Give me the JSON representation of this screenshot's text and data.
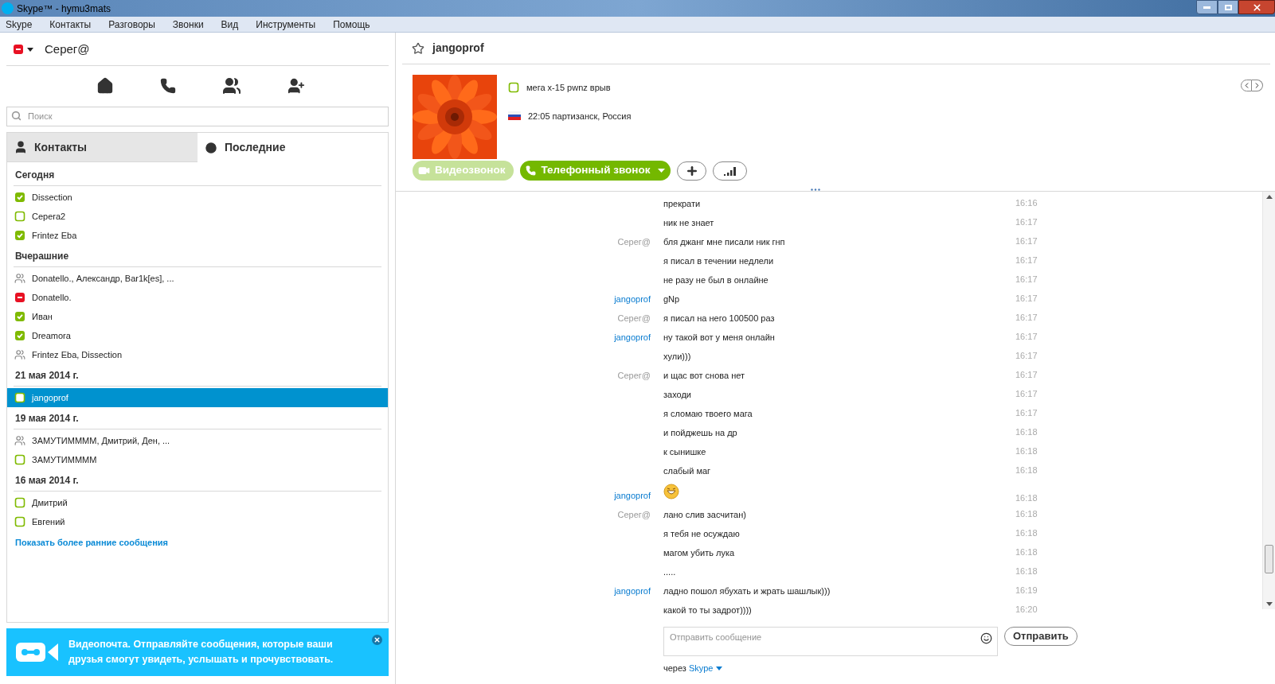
{
  "window": {
    "title": "Skype™ - hymu3mats"
  },
  "menu": [
    "Skype",
    "Контакты",
    "Разговоры",
    "Звонки",
    "Вид",
    "Инструменты",
    "Помощь"
  ],
  "profile": {
    "name": "Серег@",
    "kind": "busy"
  },
  "search": {
    "placeholder": "Поиск"
  },
  "tabs": [
    {
      "label": "Контакты",
      "kind": "contacts",
      "selected": false
    },
    {
      "label": "Последние",
      "kind": "recent",
      "selected": true
    }
  ],
  "recent_groups": [
    {
      "heading": "Сегодня",
      "items": [
        {
          "name": "Dissection",
          "kind": "online",
          "selected": false
        },
        {
          "name": "Cepera2",
          "kind": "offline",
          "selected": false
        },
        {
          "name": "Frintez Eba",
          "kind": "online",
          "selected": false
        }
      ]
    },
    {
      "heading": "Вчерашние",
      "items": [
        {
          "name": "Donatello., Александр, Bar1k[es], ...",
          "kind": "group",
          "selected": false
        },
        {
          "name": "Donatello.",
          "kind": "busy",
          "selected": false
        },
        {
          "name": "Иван",
          "kind": "online",
          "selected": false
        },
        {
          "name": "Dreamora",
          "kind": "online",
          "selected": false
        },
        {
          "name": "Frintez Eba, Dissection",
          "kind": "group",
          "selected": false
        }
      ]
    },
    {
      "heading": "21 мая 2014 г.",
      "items": [
        {
          "name": "jangoprof",
          "kind": "offline",
          "selected": true
        }
      ]
    },
    {
      "heading": "19 мая 2014 г.",
      "items": [
        {
          "name": "ЗАМУТИММММ, Дмитрий, Ден, ...",
          "kind": "group",
          "selected": false
        },
        {
          "name": "ЗАМУТИММММ",
          "kind": "offline",
          "selected": false
        }
      ]
    },
    {
      "heading": "16 мая 2014 г.",
      "items": [
        {
          "name": "Дмитрий",
          "kind": "offline",
          "selected": false
        },
        {
          "name": "Евгений",
          "kind": "offline",
          "selected": false
        }
      ]
    }
  ],
  "show_earlier_link": "Показать более ранние сообщения",
  "promo": {
    "text": "Видеопочта. Отправляйте сообщения, которые ваши друзья смогут увидеть, услышать и прочувствовать."
  },
  "chat": {
    "contact": "jangoprof",
    "favorite": false,
    "mood": {
      "text": "мега x-15 pwnz врыв",
      "kind": "offline"
    },
    "local_info": "22:05 партизанск, Россия",
    "buttons": [
      {
        "label": "Видеозвонок",
        "kind": "video",
        "disabled": true
      },
      {
        "label": "Телефонный звонок",
        "kind": "phone",
        "disabled": false
      }
    ],
    "messages": [
      {
        "kind": "text",
        "text": "прекрати",
        "time": "16:16"
      },
      {
        "kind": "text",
        "text": "ник не знает",
        "time": "16:17"
      },
      {
        "kind": "text",
        "sender": "Серег@",
        "own": true,
        "text": "бля джанг мне писали ник гнп",
        "time": "16:17"
      },
      {
        "kind": "text",
        "text": "я писал в течении недлели",
        "time": "16:17"
      },
      {
        "kind": "text",
        "text": "не разу не был в онлайне",
        "time": "16:17"
      },
      {
        "kind": "text",
        "sender": "jangoprof",
        "own": false,
        "text": "gNp",
        "time": "16:17"
      },
      {
        "kind": "text",
        "sender": "Серег@",
        "own": true,
        "text": "я писал на него 100500 раз",
        "time": "16:17"
      },
      {
        "kind": "text",
        "sender": "jangoprof",
        "own": false,
        "text": "ну такой вот у меня онлайн",
        "time": "16:17"
      },
      {
        "kind": "text",
        "text": "хули)))",
        "time": "16:17"
      },
      {
        "kind": "text",
        "sender": "Серег@",
        "own": true,
        "text": "и щас вот снова нет",
        "time": "16:17"
      },
      {
        "kind": "text",
        "text": "заходи",
        "time": "16:17"
      },
      {
        "kind": "text",
        "text": "я сломаю твоего мага",
        "time": "16:17"
      },
      {
        "kind": "text",
        "text": "и пойджешь на др",
        "time": "16:18"
      },
      {
        "kind": "text",
        "text": "к сынишке",
        "time": "16:18"
      },
      {
        "kind": "text",
        "text": "слабый маг",
        "time": "16:18"
      },
      {
        "kind": "emoji",
        "sender": "jangoprof",
        "own": false,
        "time": "16:18"
      },
      {
        "kind": "text",
        "sender": "Серег@",
        "own": true,
        "text": "лано слив засчитан)",
        "time": "16:18"
      },
      {
        "kind": "text",
        "text": "я тебя не осуждаю",
        "time": "16:18"
      },
      {
        "kind": "text",
        "text": "магом убить лука",
        "time": "16:18"
      },
      {
        "kind": "text",
        "text": ".....",
        "time": "16:18"
      },
      {
        "kind": "text",
        "sender": "jangoprof",
        "own": false,
        "text": "ладно пошол ябухать и жрать шашлык)))",
        "time": "16:19"
      },
      {
        "kind": "text",
        "text": "какой то ты задрот))))",
        "time": "16:20"
      }
    ],
    "composer": {
      "placeholder": "Отправить сообщение"
    },
    "send_button": "Отправить",
    "via_label": "через",
    "via_service": "Skype"
  }
}
